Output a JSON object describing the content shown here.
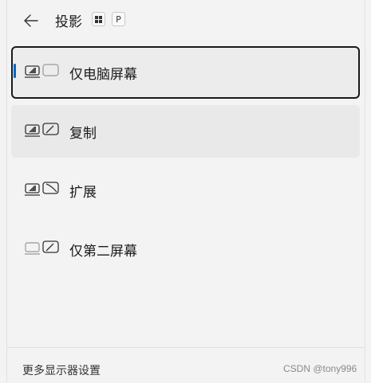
{
  "header": {
    "title": "投影",
    "shortcut_key": "P"
  },
  "options": [
    {
      "label": "仅电脑屏幕",
      "icon": "pc-screen-only-icon",
      "state": "selected"
    },
    {
      "label": "复制",
      "icon": "duplicate-icon",
      "state": "hover"
    },
    {
      "label": "扩展",
      "icon": "extend-icon",
      "state": "normal"
    },
    {
      "label": "仅第二屏幕",
      "icon": "second-screen-only-icon",
      "state": "normal"
    }
  ],
  "footer": {
    "link_label": "更多显示器设置"
  },
  "watermark": "CSDN @tony996",
  "colors": {
    "accent": "#0067c0",
    "background": "#f3f3f3",
    "selected_border": "#1a1a1a"
  }
}
